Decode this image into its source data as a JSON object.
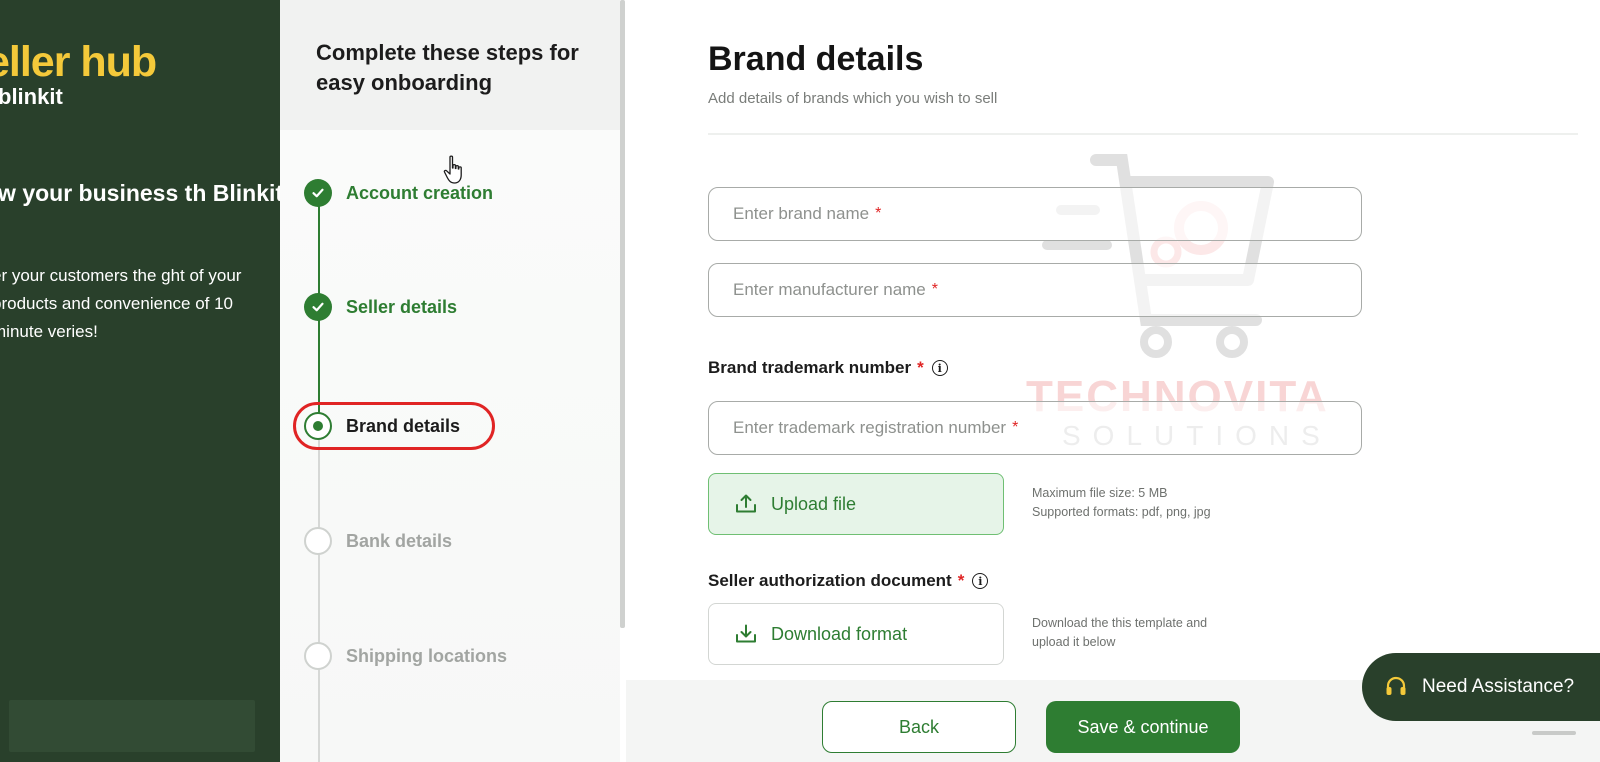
{
  "left_panel": {
    "brand_title": "eller hub",
    "brand_sub": "blinkit",
    "grow_title": "ow your business th Blinkit",
    "grow_text": "er your customers the ght of your products and convenience of 10 minute veries!"
  },
  "steps": {
    "heading": "Complete these steps for easy onboarding",
    "items": [
      {
        "label": "Account creation",
        "status": "done"
      },
      {
        "label": "Seller details",
        "status": "done"
      },
      {
        "label": "Brand details",
        "status": "current"
      },
      {
        "label": "Bank details",
        "status": "pending"
      },
      {
        "label": "Shipping locations",
        "status": "pending"
      }
    ]
  },
  "main": {
    "title": "Brand details",
    "subtitle": "Add details of brands which you wish to sell",
    "brand_name_placeholder": "Enter brand name",
    "manufacturer_placeholder": "Enter manufacturer name",
    "trademark_label": "Brand trademark number",
    "trademark_placeholder": "Enter trademark registration number",
    "required_mark": "*",
    "info_glyph": "i",
    "upload_label": "Upload file",
    "upload_help_line1": "Maximum file size: 5 MB",
    "upload_help_line2": "Supported formats: pdf, png, jpg",
    "authorization_label": "Seller authorization document",
    "download_label": "Download format",
    "download_help_line1": "Download the this template and",
    "download_help_line2": "upload it below"
  },
  "footer": {
    "back_label": "Back",
    "save_label": "Save & continue",
    "assist_label": "Need Assistance?"
  },
  "watermark": {
    "name": "TECHNOVITA",
    "sub": "SOLUTIONS"
  },
  "colors": {
    "primary_green": "#2e7d32",
    "dark_panel": "#29402b",
    "brand_yellow": "#f4c93a",
    "highlight_red": "#e02424"
  },
  "icons": {
    "step_done": "check-circle-icon",
    "step_current": "radio-dot-icon",
    "upload": "upload-icon",
    "download": "download-icon",
    "assist": "headset-icon",
    "cursor": "hand-cursor-icon"
  }
}
